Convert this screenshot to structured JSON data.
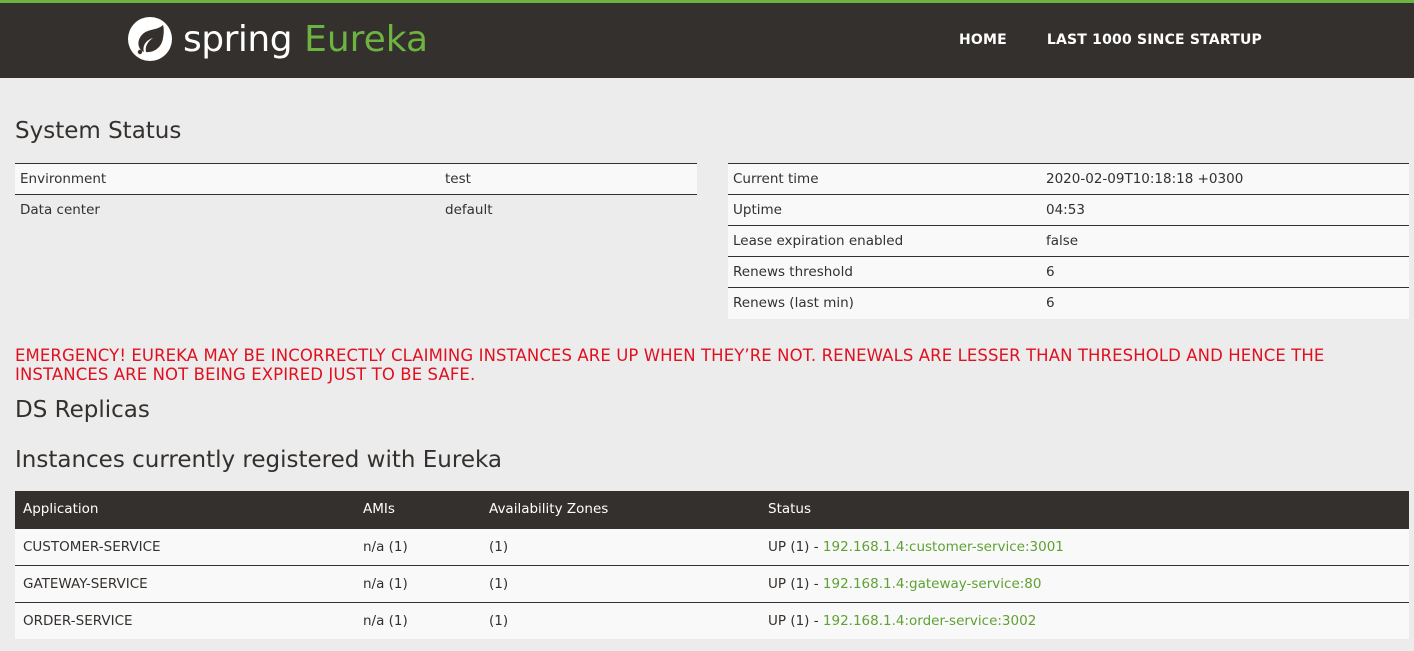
{
  "header": {
    "brand_spring": "spring",
    "brand_eureka": "Eureka",
    "nav": [
      "HOME",
      "LAST 1000 SINCE STARTUP"
    ]
  },
  "system_status": {
    "title": "System Status",
    "left": [
      {
        "label": "Environment",
        "value": "test"
      },
      {
        "label": "Data center",
        "value": "default"
      }
    ],
    "right": [
      {
        "label": "Current time",
        "value": "2020-02-09T10:18:18 +0300"
      },
      {
        "label": "Uptime",
        "value": "04:53"
      },
      {
        "label": "Lease expiration enabled",
        "value": "false"
      },
      {
        "label": "Renews threshold",
        "value": "6"
      },
      {
        "label": "Renews (last min)",
        "value": "6"
      }
    ]
  },
  "emergency": "EMERGENCY! EUREKA MAY BE INCORRECTLY CLAIMING INSTANCES ARE UP WHEN THEY’RE NOT. RENEWALS ARE LESSER THAN THRESHOLD AND HENCE THE INSTANCES ARE NOT BEING EXPIRED JUST TO BE SAFE.",
  "ds_replicas": {
    "title": "DS Replicas"
  },
  "instances": {
    "title": "Instances currently registered with Eureka",
    "columns": [
      "Application",
      "AMIs",
      "Availability Zones",
      "Status"
    ],
    "rows": [
      {
        "application": "CUSTOMER-SERVICE",
        "amis": "n/a (1)",
        "zones": "(1)",
        "status": "UP (1) - ",
        "link": "192.168.1.4:customer-service:3001"
      },
      {
        "application": "GATEWAY-SERVICE",
        "amis": "n/a (1)",
        "zones": "(1)",
        "status": "UP (1) - ",
        "link": "192.168.1.4:gateway-service:80"
      },
      {
        "application": "ORDER-SERVICE",
        "amis": "n/a (1)",
        "zones": "(1)",
        "status": "UP (1) - ",
        "link": "192.168.1.4:order-service:3002"
      }
    ]
  },
  "colors": {
    "brand_green": "#6db33f",
    "header_bg": "#34302d",
    "emergency_red": "#e0101f"
  }
}
